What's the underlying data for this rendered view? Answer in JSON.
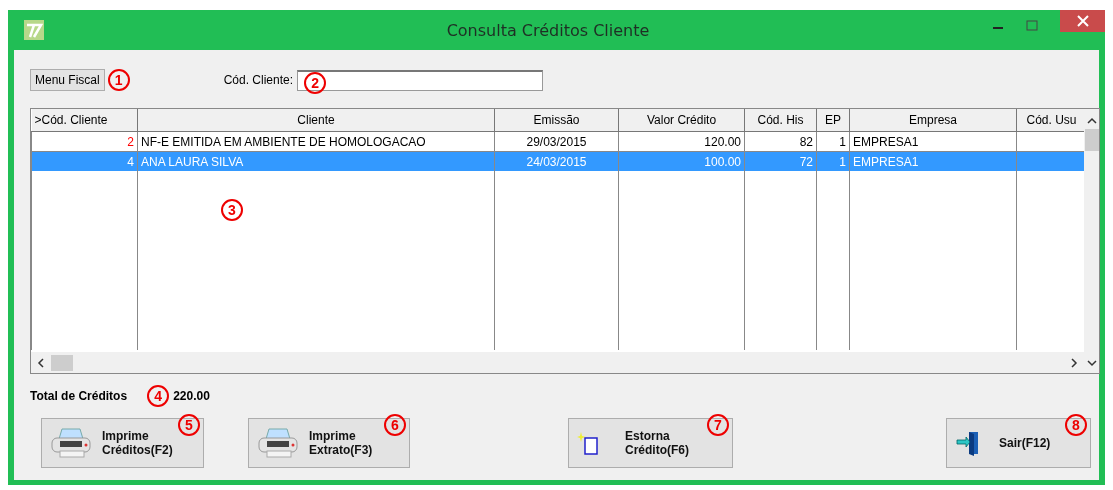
{
  "window": {
    "title": "Consulta Créditos Cliente"
  },
  "menu_button": {
    "label": "Menu Fiscal",
    "callout": "1"
  },
  "client_code": {
    "label": "Cód. Cliente:",
    "callout": "2"
  },
  "table": {
    "callout": "3",
    "columns": [
      ">Cód. Cliente",
      "Cliente",
      "Emissão",
      "Valor Crédito",
      "Cód. His",
      "EP",
      "Empresa",
      "Cód. Usu"
    ],
    "rows": [
      {
        "cells": [
          "2",
          "NF-E EMITIDA EM AMBIENTE DE HOMOLOGACAO",
          "29/03/2015",
          "120.00",
          "82",
          "1",
          "EMPRESA1",
          ""
        ],
        "flagged": true,
        "selected": false
      },
      {
        "cells": [
          "4",
          "ANA LAURA SILVA",
          "24/03/2015",
          "100.00",
          "72",
          "1",
          "EMPRESA1",
          ""
        ],
        "flagged": false,
        "selected": true
      }
    ]
  },
  "total": {
    "label": "Total de Créditos",
    "callout": "4",
    "value": "220.00"
  },
  "buttons": [
    {
      "kind": "printer",
      "line1": "Imprime",
      "line2": "Créditos(F2)",
      "callout": "5"
    },
    {
      "kind": "printer",
      "line1": "Imprime",
      "line2": "Extrato(F3)",
      "callout": "6"
    },
    {
      "kind": "new",
      "line1": "Estorna",
      "line2": "Crédito(F6)",
      "callout": "7"
    },
    {
      "kind": "exit",
      "line1": "Sair(F12)",
      "callout": "8"
    }
  ]
}
